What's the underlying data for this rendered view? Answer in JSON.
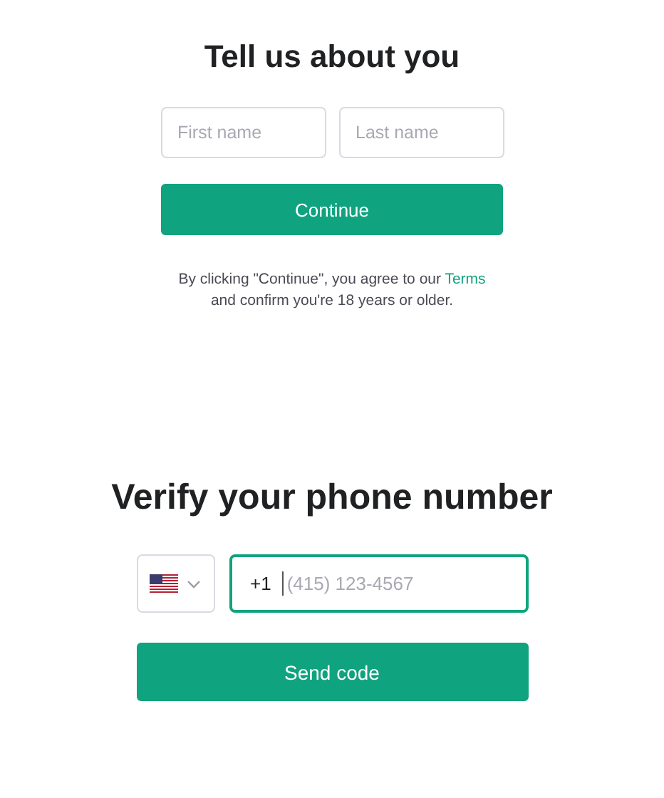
{
  "name_form": {
    "title": "Tell us about you",
    "fields": [
      {
        "placeholder": "First name"
      },
      {
        "placeholder": "Last name"
      }
    ],
    "button": "Continue",
    "legal": {
      "before": "By clicking \"Continue\", you agree to our",
      "link": "Terms",
      "after": "and confirm you're 18 years or older."
    }
  },
  "phone_form": {
    "title": "Verify your phone number",
    "country_select": {
      "expanded": false
    },
    "phone_field": {
      "prefix": "+1",
      "placeholder": "(415) 123-4567",
      "focused": true
    },
    "button": "Send code"
  }
}
